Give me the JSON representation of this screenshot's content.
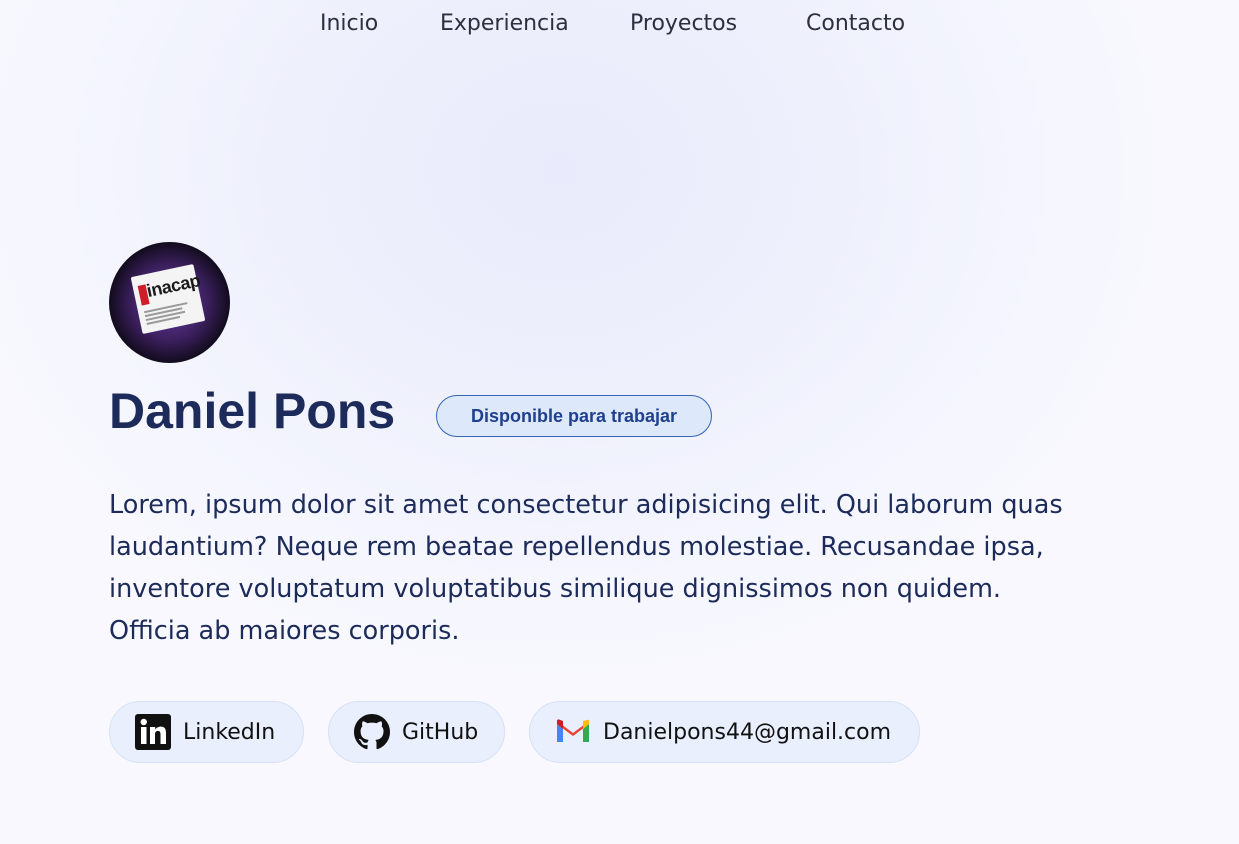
{
  "nav": {
    "items": [
      {
        "label": "Inicio"
      },
      {
        "label": "Experiencia"
      },
      {
        "label": "Proyectos"
      },
      {
        "label": "Contacto"
      }
    ]
  },
  "profile": {
    "avatar_icon": "inacap-logo-icon",
    "avatar_logo_text": "inacap",
    "name": "Daniel Pons",
    "badge": "Disponible para trabajar",
    "bio": "Lorem, ipsum dolor sit amet consectetur adipisicing elit. Qui laborum quas laudantium? Neque rem beatae repellendus molestiae. Recusandae ipsa, inventore voluptatum voluptatibus similique dignissimos non quidem. Officia ab maiores corporis."
  },
  "social": {
    "links": [
      {
        "label": "LinkedIn",
        "icon": "linkedin-icon"
      },
      {
        "label": "GitHub",
        "icon": "github-icon"
      },
      {
        "label": "Danielpons44@gmail.com",
        "icon": "gmail-icon"
      }
    ]
  },
  "colors": {
    "heading": "#1c2b59",
    "badge_border": "#3563b5",
    "badge_bg": "#dde8fb",
    "chip_bg": "#e9effc"
  }
}
